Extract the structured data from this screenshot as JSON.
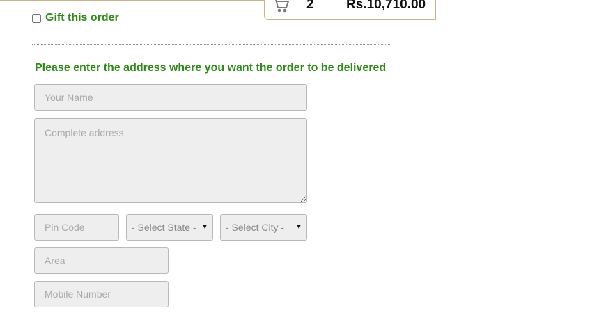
{
  "cart": {
    "icon": "shopping-cart-icon",
    "count": "2",
    "total": "Rs.10,710.00"
  },
  "gift": {
    "label": "Gift this order",
    "checked": false
  },
  "instruction": "Please enter the address where you want the order to be delivered",
  "form": {
    "name_placeholder": "Your Name",
    "address_placeholder": "Complete address",
    "pincode_placeholder": "Pin Code",
    "state_select": "- Select State -",
    "city_select": "- Select City -",
    "area_placeholder": "Area",
    "mobile_placeholder": "Mobile Number"
  },
  "colors": {
    "accent_green": "#2f8a1a",
    "border_tan": "#c9b48a",
    "field_bg": "#eeeeee"
  }
}
